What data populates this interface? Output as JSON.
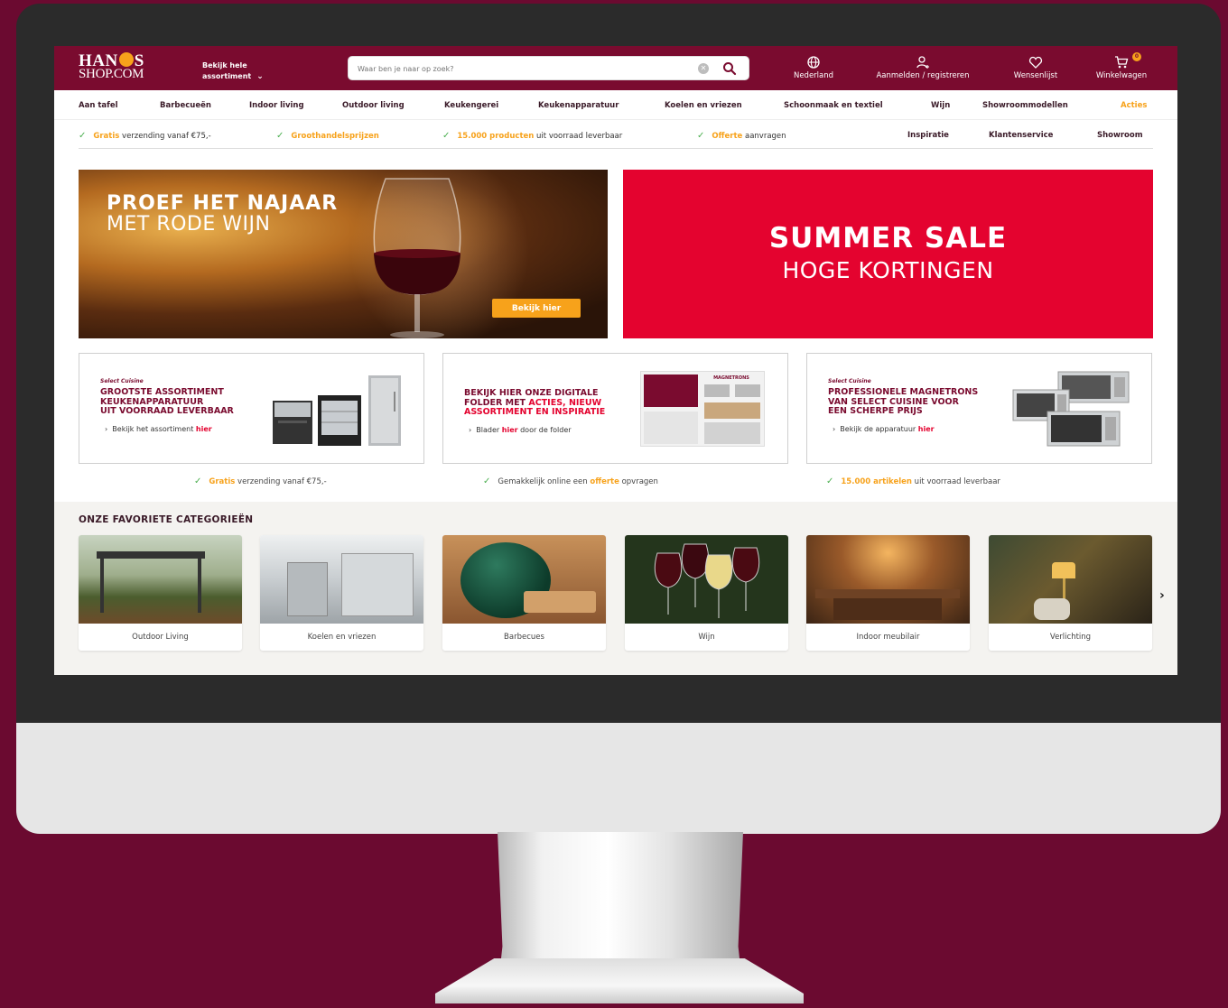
{
  "header": {
    "logo_line1a": "HAN",
    "logo_line1b": "S",
    "logo_line2": "SHOP.COM",
    "assortment_line1": "Bekijk hele",
    "assortment_line2": "assortiment",
    "search_placeholder": "Waar ben je naar op zoek?",
    "country": "Nederland",
    "login": "Aanmelden / registreren",
    "wishlist": "Wensenlijst",
    "cart": "Winkelwagen",
    "cart_count": "0"
  },
  "nav": {
    "items": [
      "Aan tafel",
      "Barbecueën",
      "Indoor living",
      "Outdoor living",
      "Keukengerei",
      "Keukenapparatuur",
      "Koelen en vriezen",
      "Schoonmaak en textiel",
      "Wijn",
      "Showroommodellen",
      "Acties"
    ]
  },
  "usp": {
    "shipping_hl": "Gratis",
    "shipping_rest": " verzending vanaf €75,-",
    "wholesale_hl": "Groothandelsprijzen",
    "stock_hl": "15.000 producten",
    "stock_rest": " uit voorraad leverbaar",
    "quote_hl": "Offerte",
    "quote_rest": " aanvragen",
    "links": [
      "Inspiratie",
      "Klantenservice",
      "Showroom"
    ]
  },
  "hero": {
    "left_title1": "PROEF HET NAJAAR",
    "left_title2": "MET RODE WIJN",
    "left_button": "Bekijk hier",
    "right_title1": "SUMMER SALE",
    "right_title2": "HOGE KORTINGEN"
  },
  "promos": [
    {
      "brand": "Select Cuisine",
      "title_line1": "GROOTSTE ASSORTIMENT",
      "title_line2": "KEUKENAPPARATUUR",
      "title_line3": "UIT VOORRAAD LEVERBAAR",
      "link_pre": "Bekijk het assortiment ",
      "link_hl": "hier",
      "link_post": ""
    },
    {
      "title_line1": "BEKIJK HIER ONZE DIGITALE",
      "title_line2a": "FOLDER MET ",
      "title_line2b": "ACTIES, NIEUW",
      "title_line3": "ASSORTIMENT EN INSPIRATIE",
      "link_pre": "Blader ",
      "link_hl": "hier",
      "link_post": " door de folder",
      "folder_label": "MAGNETRONS"
    },
    {
      "brand": "Select Cuisine",
      "title_line1": "PROFESSIONELE MAGNETRONS",
      "title_line2": "VAN SELECT CUISINE VOOR",
      "title_line3": "EEN SCHERPE PRIJS",
      "link_pre": "Bekijk de apparatuur ",
      "link_hl": "hier",
      "link_post": ""
    }
  ],
  "usp2": {
    "a_hl": "Gratis",
    "a_rest": " verzending vanaf €75,-",
    "b_pre": "Gemakkelijk online een ",
    "b_hl": "offerte",
    "b_post": " opvragen",
    "c_hl": "15.000 artikelen",
    "c_rest": " uit voorraad leverbaar"
  },
  "categories": {
    "heading": "ONZE FAVORIETE CATEGORIEËN",
    "items": [
      "Outdoor Living",
      "Koelen en vriezen",
      "Barbecues",
      "Wijn",
      "Indoor meubilair",
      "Verlichting"
    ]
  },
  "colors": {
    "brand": "#7a0b2f",
    "accent": "#f7a21b",
    "sale_red": "#e4032f",
    "background": "#6b0a30"
  },
  "icons": {
    "globe": "globe-icon",
    "user": "user-icon",
    "heart": "heart-icon",
    "cart": "cart-icon",
    "search": "search-icon",
    "check": "check-icon",
    "chevron": "chevron-right-icon"
  }
}
